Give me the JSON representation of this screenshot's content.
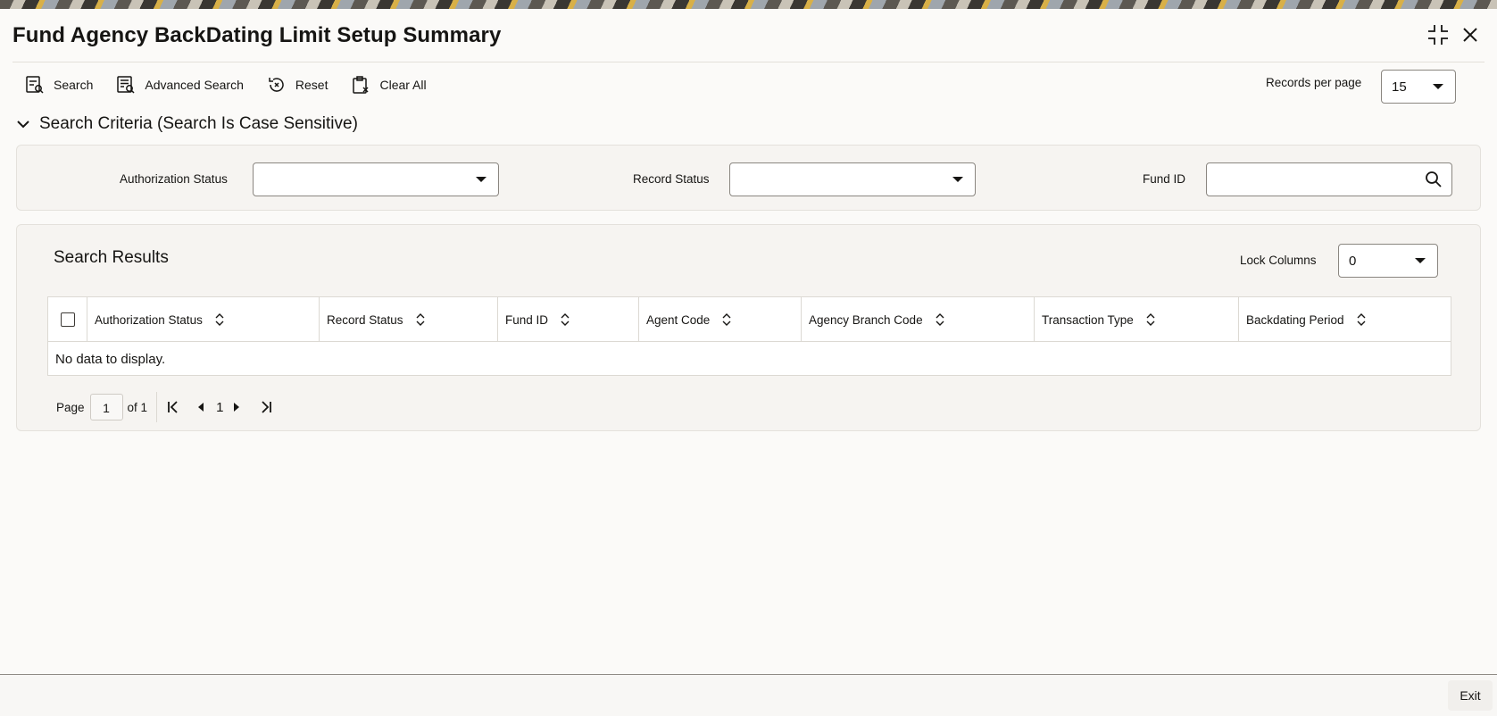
{
  "window": {
    "title": "Fund Agency BackDating Limit Setup Summary"
  },
  "toolbar": {
    "search_label": "Search",
    "advanced_search_label": "Advanced Search",
    "reset_label": "Reset",
    "clear_all_label": "Clear All",
    "records_per_page_label": "Records per page",
    "records_per_page_value": "15"
  },
  "criteria": {
    "title": "Search Criteria (Search Is Case Sensitive)",
    "authorization_status_label": "Authorization Status",
    "authorization_status_value": "",
    "record_status_label": "Record Status",
    "record_status_value": "",
    "fund_id_label": "Fund ID",
    "fund_id_value": ""
  },
  "results": {
    "title": "Search Results",
    "lock_columns_label": "Lock Columns",
    "lock_columns_value": "0",
    "columns": [
      "Authorization Status",
      "Record Status",
      "Fund ID",
      "Agent Code",
      "Agency Branch Code",
      "Transaction Type",
      "Backdating Period"
    ],
    "rows": [],
    "empty_message": "No data to display."
  },
  "pager": {
    "page_label": "Page",
    "current_page": "1",
    "of_label": "of 1",
    "page_number": "1"
  },
  "footer": {
    "exit_label": "Exit"
  }
}
